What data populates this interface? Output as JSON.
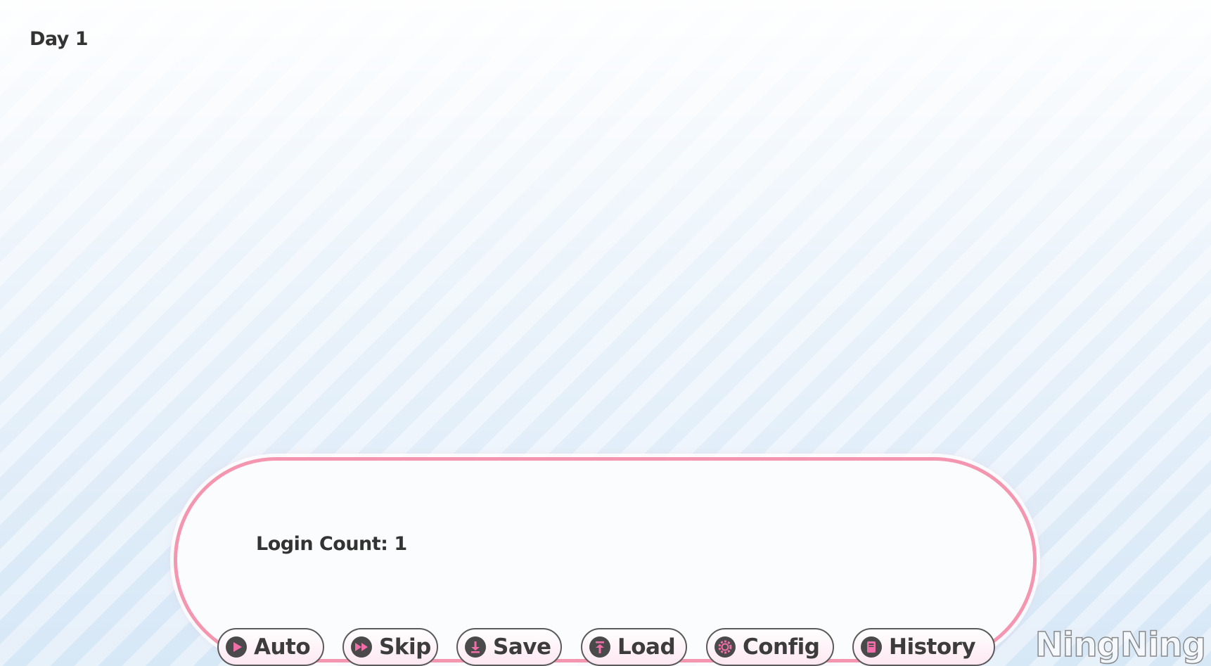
{
  "hud": {
    "day": "Day 1"
  },
  "dialogue": {
    "text": "Login Count: 1"
  },
  "menu": {
    "auto": "Auto",
    "skip": "Skip",
    "save": "Save",
    "load": "Load",
    "config": "Config",
    "history": "History"
  },
  "watermark": "NingNing",
  "colors": {
    "accent_pink": "#f596b0",
    "icon_pink": "#f06fa8",
    "text_dark": "#333333"
  },
  "icons": {
    "auto": "play-icon",
    "skip": "fast-forward-icon",
    "save": "download-icon",
    "load": "upload-icon",
    "config": "gear-icon",
    "history": "book-icon"
  }
}
